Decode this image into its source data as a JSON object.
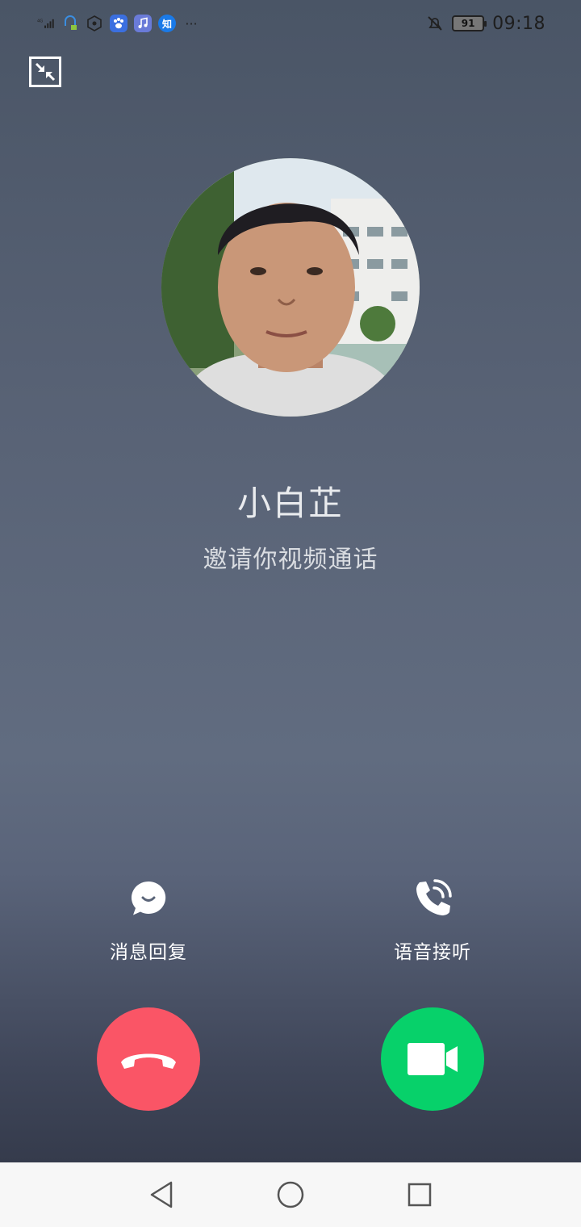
{
  "status_bar": {
    "network": "4G",
    "app_icons": [
      "bluetooth-icon",
      "hexagon-icon",
      "paw-icon",
      "music-icon",
      "zhihu-icon"
    ],
    "zhihu_label": "知",
    "more": "···",
    "battery": "91",
    "time": "09:18"
  },
  "caller": {
    "name": "小白芷",
    "subtitle": "邀请你视频通话"
  },
  "actions": {
    "message_reply": "消息回复",
    "voice_answer": "语音接听"
  },
  "colors": {
    "decline": "#fa5566",
    "accept": "#07d16a"
  }
}
